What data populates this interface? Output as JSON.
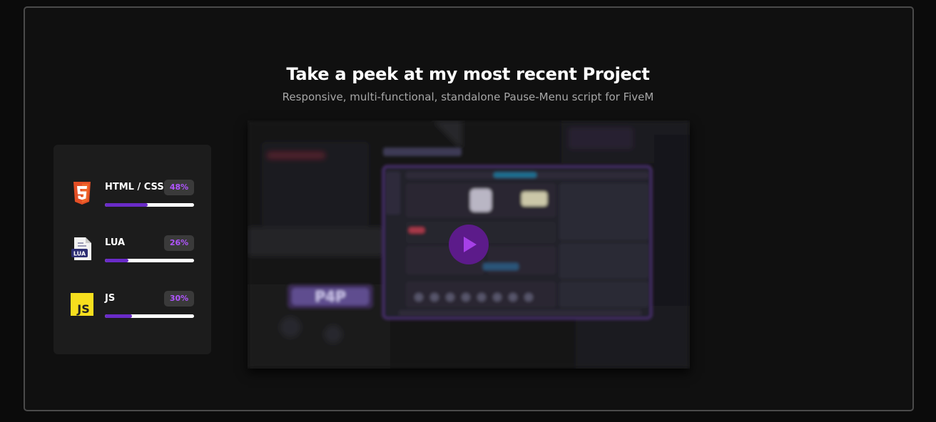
{
  "section": {
    "title": "Take a peek at my most recent Project",
    "subtitle": "Responsive, multi-functional, standalone Pause-Menu script for FiveM"
  },
  "skills": [
    {
      "name": "HTML / CSS",
      "percent_label": "48%",
      "percent": 48,
      "icon": "html5-icon"
    },
    {
      "name": "LUA",
      "percent_label": "26%",
      "percent": 26,
      "icon": "lua-file-icon"
    },
    {
      "name": "JS",
      "percent_label": "30%",
      "percent": 30,
      "icon": "javascript-icon"
    }
  ],
  "video": {
    "thumbnail_logo_text": "P4P",
    "play_icon": "play-icon"
  },
  "colors": {
    "accent": "#b055ff",
    "bar_fill": "#6a2bc8",
    "html5": "#e34f26",
    "js": "#f7df1e",
    "play_button": "#5c1b8a"
  }
}
